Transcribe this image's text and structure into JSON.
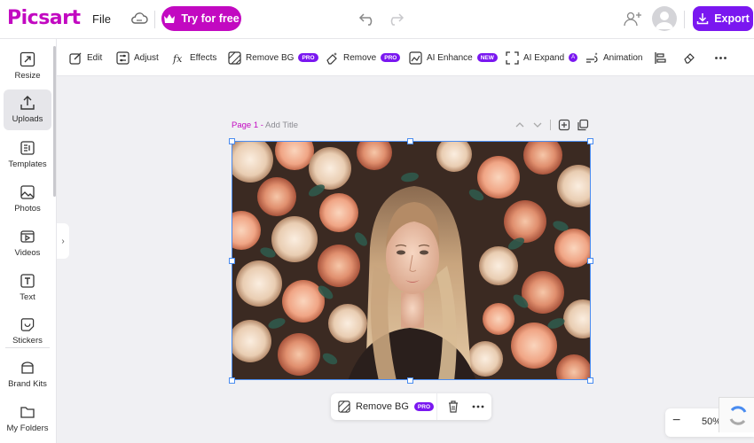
{
  "header": {
    "logo": "Picsart",
    "file_label": "File",
    "try_label": "Try for free",
    "export_label": "Export"
  },
  "sidebar": {
    "items": [
      {
        "label": "Resize",
        "icon": "resize-icon"
      },
      {
        "label": "Uploads",
        "icon": "upload-icon"
      },
      {
        "label": "Templates",
        "icon": "templates-icon"
      },
      {
        "label": "Photos",
        "icon": "photos-icon"
      },
      {
        "label": "Videos",
        "icon": "videos-icon"
      },
      {
        "label": "Text",
        "icon": "text-icon"
      },
      {
        "label": "Stickers",
        "icon": "stickers-icon"
      },
      {
        "label": "Brand Kits",
        "icon": "brand-kits-icon"
      },
      {
        "label": "My Folders",
        "icon": "folders-icon"
      }
    ],
    "active_index": 1
  },
  "toolbar": {
    "edit": "Edit",
    "adjust": "Adjust",
    "effects": "Effects",
    "remove_bg": "Remove BG",
    "remove": "Remove",
    "ai_enhance": "AI Enhance",
    "ai_expand": "AI Expand",
    "animation": "Animation",
    "pro_badge": "PRO",
    "new_badge": "NEW",
    "ai_badge": "A"
  },
  "page": {
    "label": "Page 1 -",
    "title_placeholder": "Add Title"
  },
  "context_bar": {
    "remove_bg": "Remove BG",
    "pro_badge": "PRO"
  },
  "zoom": {
    "minus": "−",
    "value": "50%",
    "plus": "+"
  },
  "colors": {
    "brand": "#c209c1",
    "accent": "#7a17f0",
    "selection": "#4a8cf0"
  }
}
